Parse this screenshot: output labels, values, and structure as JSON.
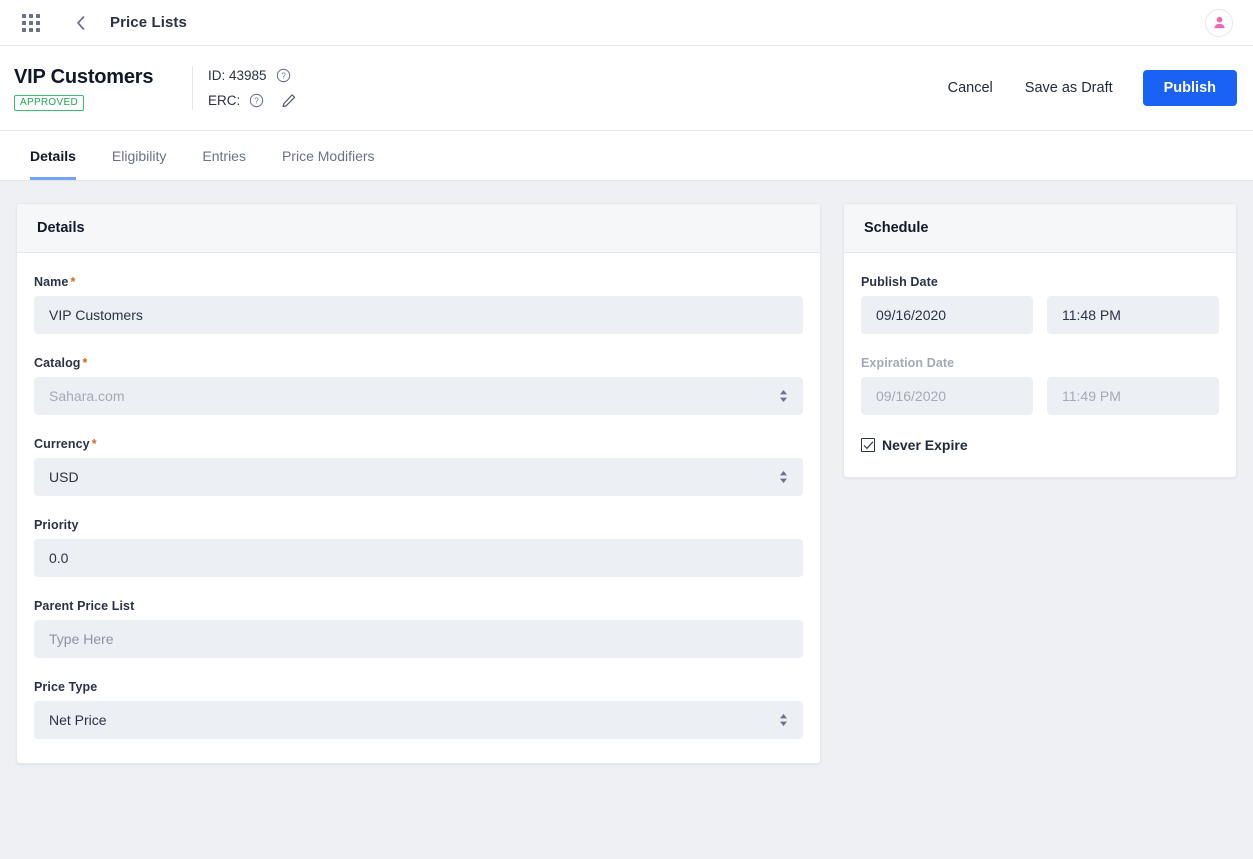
{
  "appbar": {
    "grid_icon": "grid-menu-icon",
    "back_icon": "back-chevron-icon",
    "title": "Price Lists",
    "avatar_icon": "user-avatar-icon"
  },
  "header": {
    "title": "VIP Customers",
    "status_badge": "APPROVED",
    "id_label": "ID: 43985",
    "erc_label": "ERC:",
    "help_icon": "help-circle-icon",
    "edit_icon": "pencil-edit-icon",
    "actions": {
      "cancel": "Cancel",
      "save_draft": "Save as Draft",
      "publish": "Publish"
    }
  },
  "tabs": [
    {
      "label": "Details",
      "active": true
    },
    {
      "label": "Eligibility",
      "active": false
    },
    {
      "label": "Entries",
      "active": false
    },
    {
      "label": "Price Modifiers",
      "active": false
    }
  ],
  "details": {
    "card_title": "Details",
    "fields": {
      "name": {
        "label": "Name",
        "required": "*",
        "value": "VIP Customers"
      },
      "catalog": {
        "label": "Catalog",
        "required": "*",
        "value": "Sahara.com"
      },
      "currency": {
        "label": "Currency",
        "required": "*",
        "value": "USD"
      },
      "priority": {
        "label": "Priority",
        "value": "0.0"
      },
      "parent_price_list": {
        "label": "Parent Price List",
        "placeholder": "Type Here"
      },
      "price_type": {
        "label": "Price Type",
        "value": "Net Price"
      }
    }
  },
  "schedule": {
    "card_title": "Schedule",
    "publish_date": {
      "label": "Publish Date",
      "date": "09/16/2020",
      "time": "11:48 PM"
    },
    "expiration_date": {
      "label": "Expiration Date",
      "date": "09/16/2020",
      "time": "11:49 PM"
    },
    "never_expire": {
      "label": "Never Expire",
      "checked": true
    }
  },
  "colors": {
    "primary": "#1a62f5",
    "tab_underline": "#74a4f5",
    "badge_green": "#22a35b",
    "required_star": "#d2691e",
    "input_bg": "#eceff3",
    "page_bg": "#eef0f4",
    "avatar_pink": "#f264b8"
  }
}
